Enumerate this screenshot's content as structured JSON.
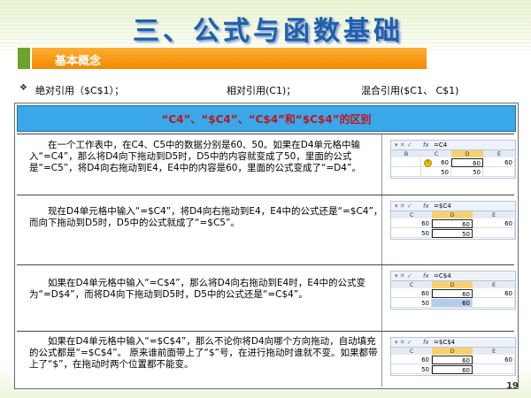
{
  "title": "三、公式与函数基础",
  "section_label": "基本概念",
  "bullets": {
    "icon": "diamond-bullet-icon",
    "absolute": "绝对引用（$C$1）；",
    "relative": "相对引用(C1)；",
    "mixed": "混合引用($C1、 C$1)"
  },
  "table": {
    "header": "“C4”、“$C4”、“C$4”和“$C$4”的区别",
    "rows": [
      {
        "text": "　　在一个工作表中，在C4、C5中的数据分别是60、50。如果在D4单元格中输入“=C4”，那么将D4向下拖动到D5时，D5中的内容就变成了50，里面的公式是“=C5”，将D4向右拖动到E4，E4中的内容是60，里面的公式变成了“=D4”。",
        "sheet": {
          "formula": "=C4",
          "fx": "fx",
          "cols": [
            "B",
            "C",
            "D",
            "E"
          ],
          "r1": [
            "",
            "60",
            "60",
            "60"
          ],
          "r2": [
            "",
            "50",
            "50",
            ""
          ]
        }
      },
      {
        "text": "　　现在D4单元格中输入“=$C4”，将D4向右拖动到E4，E4中的公式还是“=$C4”，而向下拖动到D5时，D5中的公式就成了“=$C5”。",
        "sheet": {
          "formula": "=$C4",
          "fx": "fx",
          "cols": [
            "C",
            "D",
            "E"
          ],
          "r1": [
            "60",
            "60",
            "60"
          ],
          "r2": [
            "50",
            "50",
            ""
          ]
        }
      },
      {
        "text": "　　如果在D4单元格中输入“=C$4”，那么将D4向右拖动到E4时，E4中的公式变为“=D$4”，而将D4向下拖动到D5时，D5中的公式还是“=C$4”。",
        "sheet": {
          "formula": "=C$4",
          "fx": "fx",
          "cols": [
            "C",
            "D",
            "E"
          ],
          "r1": [
            "60",
            "60",
            "60"
          ],
          "r2": [
            "50",
            "60",
            ""
          ]
        }
      },
      {
        "text": "　　如果在D4单元格中输入“=$C$4”，那么不论你将D4向哪个方向拖动，自动填充的公式都是“=$C$4”。 原来谁前面带上了“$”号，在进行拖动时谁就不变。如果都带上了“$”，在拖动时两个位置都不能变。",
        "sheet": {
          "formula": "=$C$4",
          "fx": "fx",
          "cols": [
            "C",
            "D",
            "E"
          ],
          "r1": [
            "60",
            "60",
            "60"
          ],
          "r2": [
            "50",
            "60",
            ""
          ]
        }
      }
    ]
  },
  "page_number": "19",
  "colors": {
    "title": "#1f5fae",
    "orange": "#f39a10",
    "green": "#6ca32c",
    "header_bg": "#3aa8e8",
    "header_text": "#c0141c"
  }
}
